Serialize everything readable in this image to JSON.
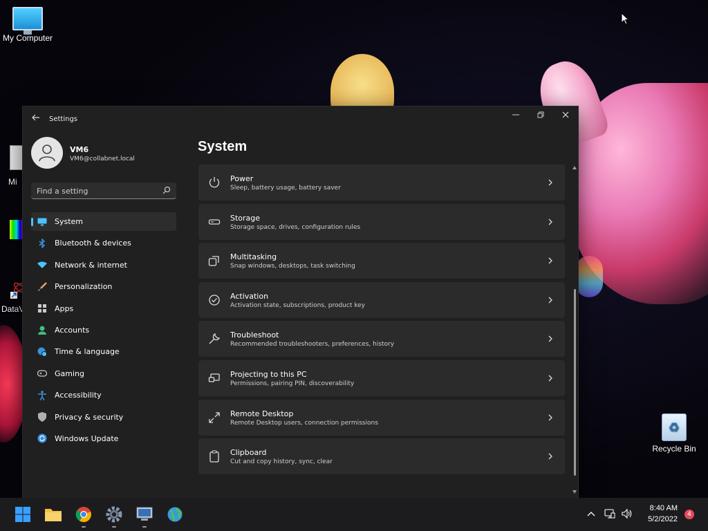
{
  "desktop": {
    "icons": {
      "my_computer": "My Computer",
      "partial_1": "Mi",
      "partial_2": "DataV",
      "recycle_bin": "Recycle Bin"
    }
  },
  "window": {
    "title": "Settings",
    "controls": [
      "minimize",
      "restore",
      "close"
    ]
  },
  "account": {
    "name": "VM6",
    "email": "VM6@collabnet.local"
  },
  "search": {
    "placeholder": "Find a setting"
  },
  "nav": {
    "items": [
      {
        "label": "System",
        "icon": "monitor-icon",
        "color": "#4cc2ff",
        "active": true
      },
      {
        "label": "Bluetooth & devices",
        "icon": "bluetooth-icon",
        "color": "#3b8fe0"
      },
      {
        "label": "Network & internet",
        "icon": "wifi-icon",
        "color": "#4cc2ff"
      },
      {
        "label": "Personalization",
        "icon": "brush-icon",
        "color": "#e8a36a"
      },
      {
        "label": "Apps",
        "icon": "apps-icon",
        "color": "#c9c9c9"
      },
      {
        "label": "Accounts",
        "icon": "person-icon",
        "color": "#3fbf7f"
      },
      {
        "label": "Time & language",
        "icon": "globe-clock-icon",
        "color": "#4cc2ff"
      },
      {
        "label": "Gaming",
        "icon": "gamepad-icon",
        "color": "#c9c9c9"
      },
      {
        "label": "Accessibility",
        "icon": "accessibility-icon",
        "color": "#3b8fe0"
      },
      {
        "label": "Privacy & security",
        "icon": "shield-icon",
        "color": "#b0b0b0"
      },
      {
        "label": "Windows Update",
        "icon": "update-icon",
        "color": "#3b8fe0"
      }
    ]
  },
  "main": {
    "title": "System",
    "rows": [
      {
        "title": "Power",
        "subtitle": "Sleep, battery usage, battery saver",
        "icon": "power-icon"
      },
      {
        "title": "Storage",
        "subtitle": "Storage space, drives, configuration rules",
        "icon": "storage-icon"
      },
      {
        "title": "Multitasking",
        "subtitle": "Snap windows, desktops, task switching",
        "icon": "multitasking-icon"
      },
      {
        "title": "Activation",
        "subtitle": "Activation state, subscriptions, product key",
        "icon": "activation-icon"
      },
      {
        "title": "Troubleshoot",
        "subtitle": "Recommended troubleshooters, preferences, history",
        "icon": "wrench-icon"
      },
      {
        "title": "Projecting to this PC",
        "subtitle": "Permissions, pairing PIN, discoverability",
        "icon": "projecting-icon"
      },
      {
        "title": "Remote Desktop",
        "subtitle": "Remote Desktop users, connection permissions",
        "icon": "remote-desktop-icon"
      },
      {
        "title": "Clipboard",
        "subtitle": "Cut and copy history, sync, clear",
        "icon": "clipboard-icon"
      }
    ]
  },
  "taskbar": {
    "apps": [
      "start-icon",
      "file-explorer-icon",
      "chrome-icon",
      "settings-gear-icon",
      "remote-desktop-app-icon",
      "globe-app-icon"
    ],
    "tray": [
      "chevron-up-icon",
      "network-icon",
      "volume-icon"
    ],
    "time": "8:40 AM",
    "date": "5/2/2022",
    "notification_count": "4"
  },
  "colors": {
    "accent": "#4cc2ff",
    "window_bg": "#202020",
    "card_bg": "#2b2b2b",
    "badge": "#e8485a"
  }
}
